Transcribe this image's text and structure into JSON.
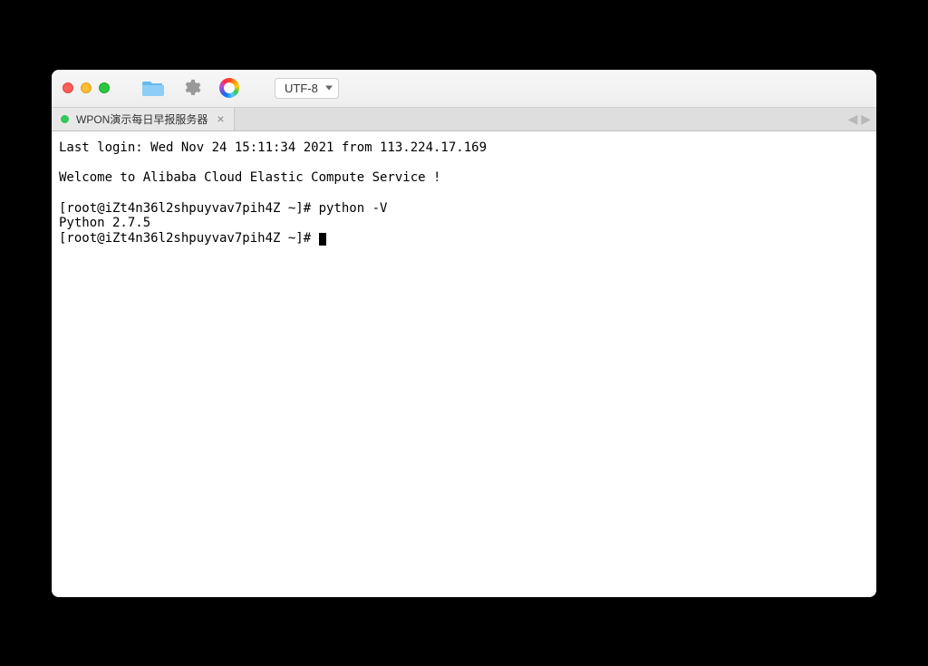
{
  "toolbar": {
    "encoding": "UTF-8"
  },
  "tab": {
    "title": "WPON演示每日早报服务器"
  },
  "terminal": {
    "line1": "Last login: Wed Nov 24 15:11:34 2021 from 113.224.17.169",
    "line2": "",
    "line3": "Welcome to Alibaba Cloud Elastic Compute Service !",
    "line4": "",
    "prompt1": "[root@iZt4n36l2shpuyvav7pih4Z ~]# python -V",
    "output1": "Python 2.7.5",
    "prompt2": "[root@iZt4n36l2shpuyvav7pih4Z ~]# "
  }
}
